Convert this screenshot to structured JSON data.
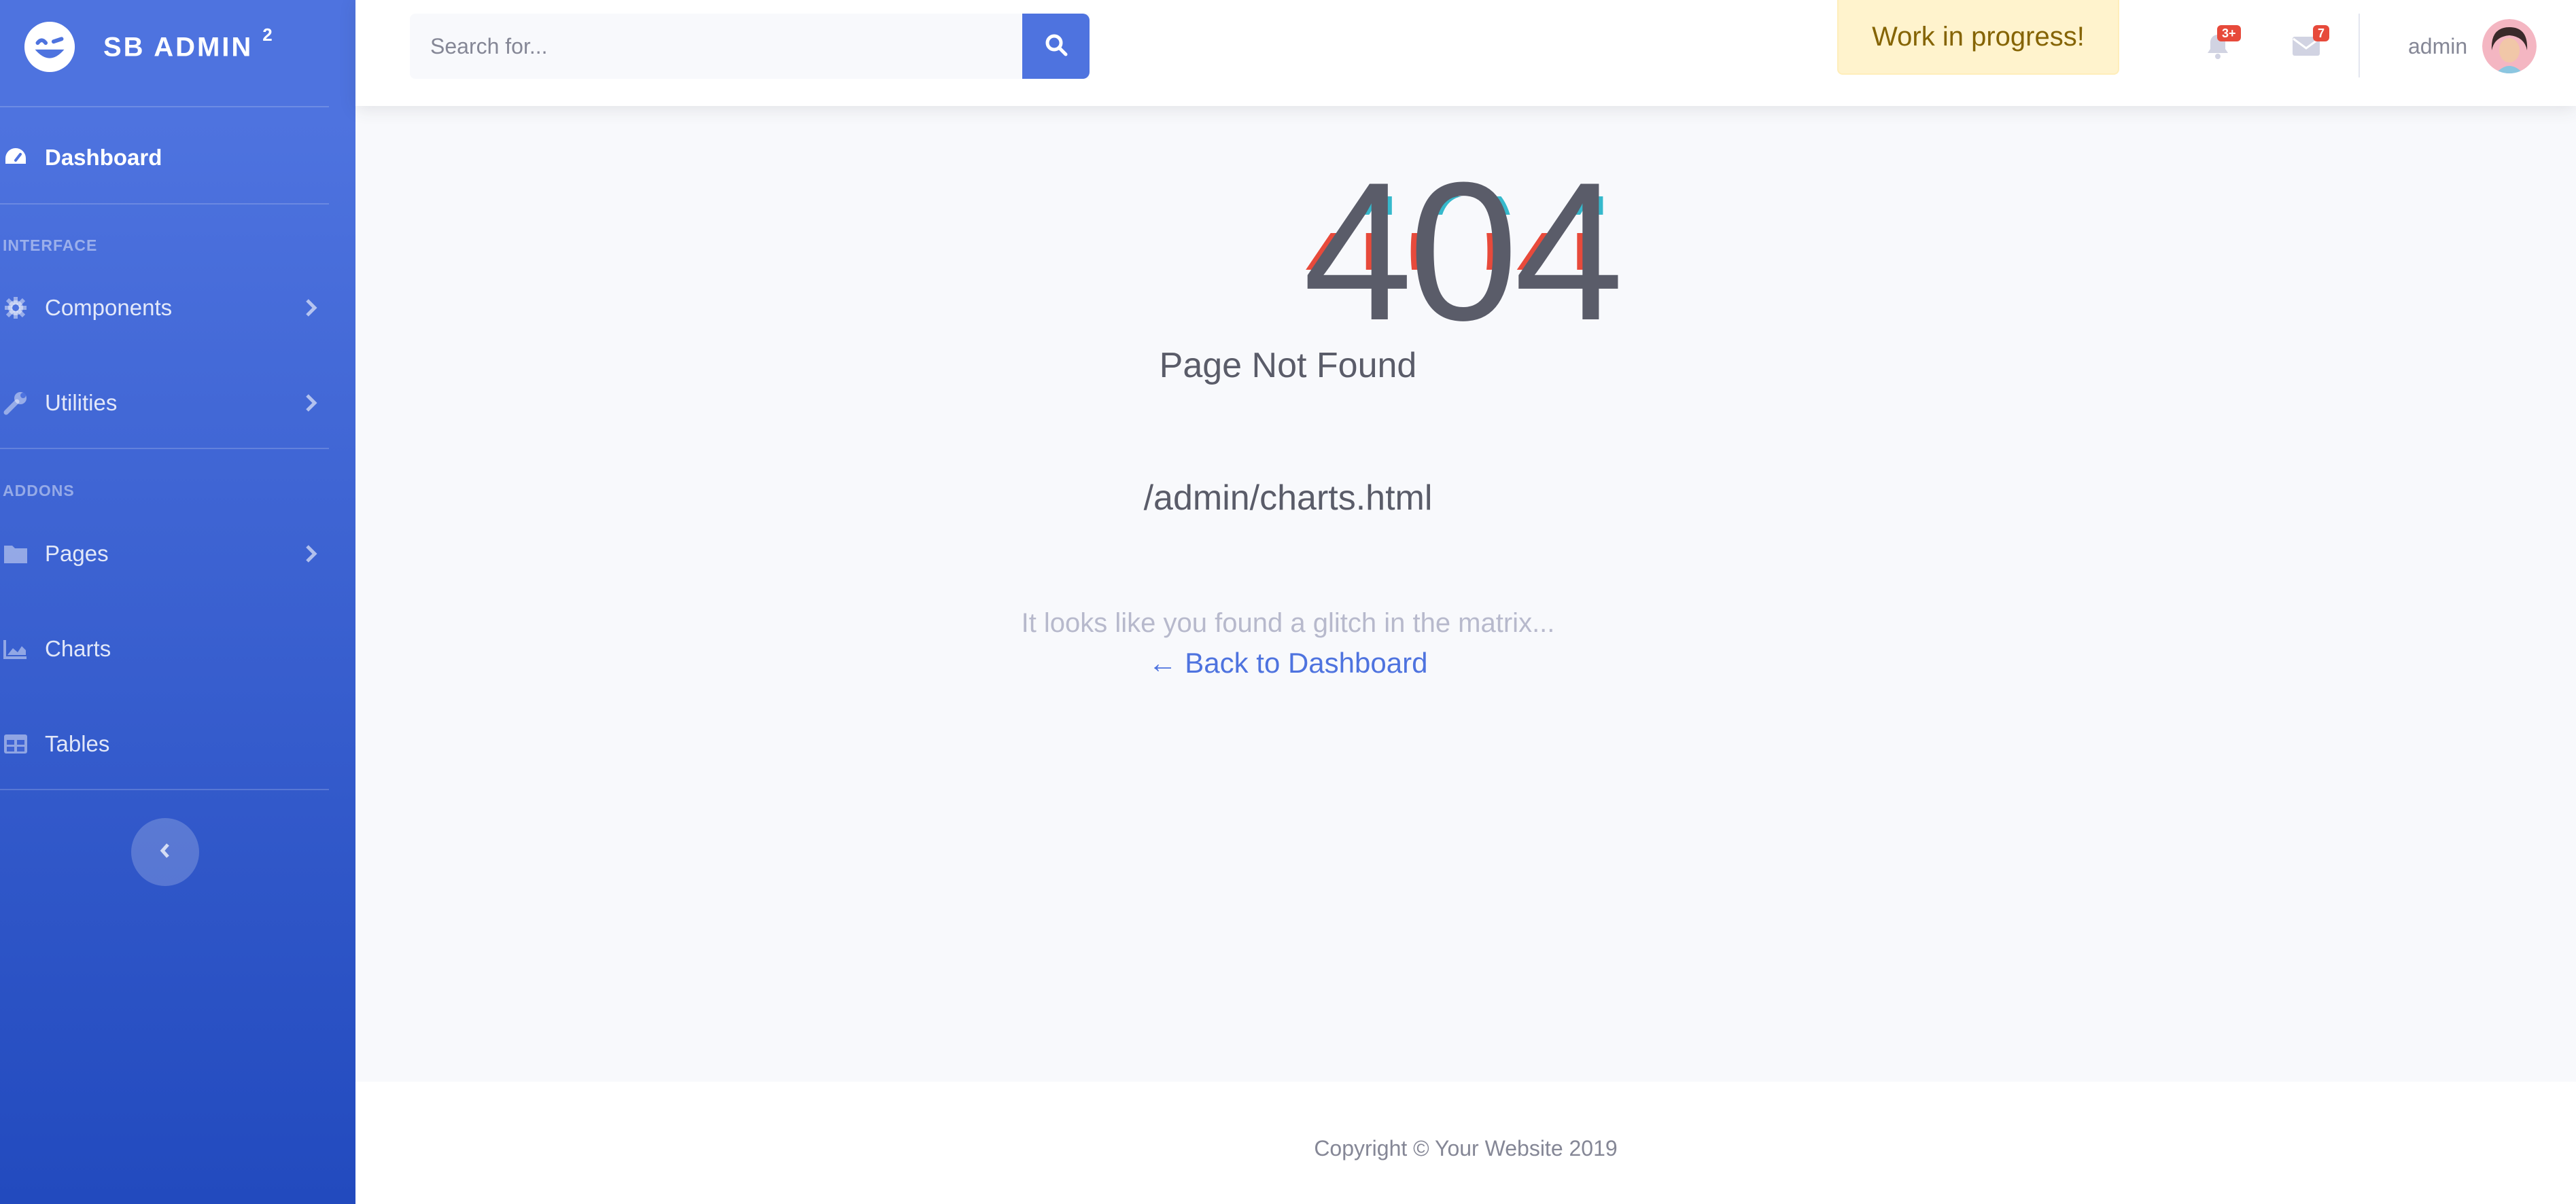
{
  "brand": {
    "name": "SB ADMIN",
    "superscript": "2"
  },
  "sidebar": {
    "dashboard": "Dashboard",
    "section_interface": "INTERFACE",
    "components": "Components",
    "utilities": "Utilities",
    "section_addons": "ADDONS",
    "pages": "Pages",
    "charts": "Charts",
    "tables": "Tables"
  },
  "topbar": {
    "search_placeholder": "Search for...",
    "wip": "Work in progress!",
    "alerts_badge": "3+",
    "messages_badge": "7",
    "user": "admin"
  },
  "error": {
    "code": "404",
    "title": "Page Not Found",
    "path": "/admin/charts.html",
    "message": "It looks like you found a glitch in the matrix...",
    "back": "← Back to Dashboard"
  },
  "footer": {
    "copyright": "Copyright © Your Website 2019"
  },
  "colors": {
    "primary": "#4e73df",
    "sidebar_bottom": "#224abe",
    "danger": "#e74a3b",
    "warning_bg": "#fff3cd"
  }
}
